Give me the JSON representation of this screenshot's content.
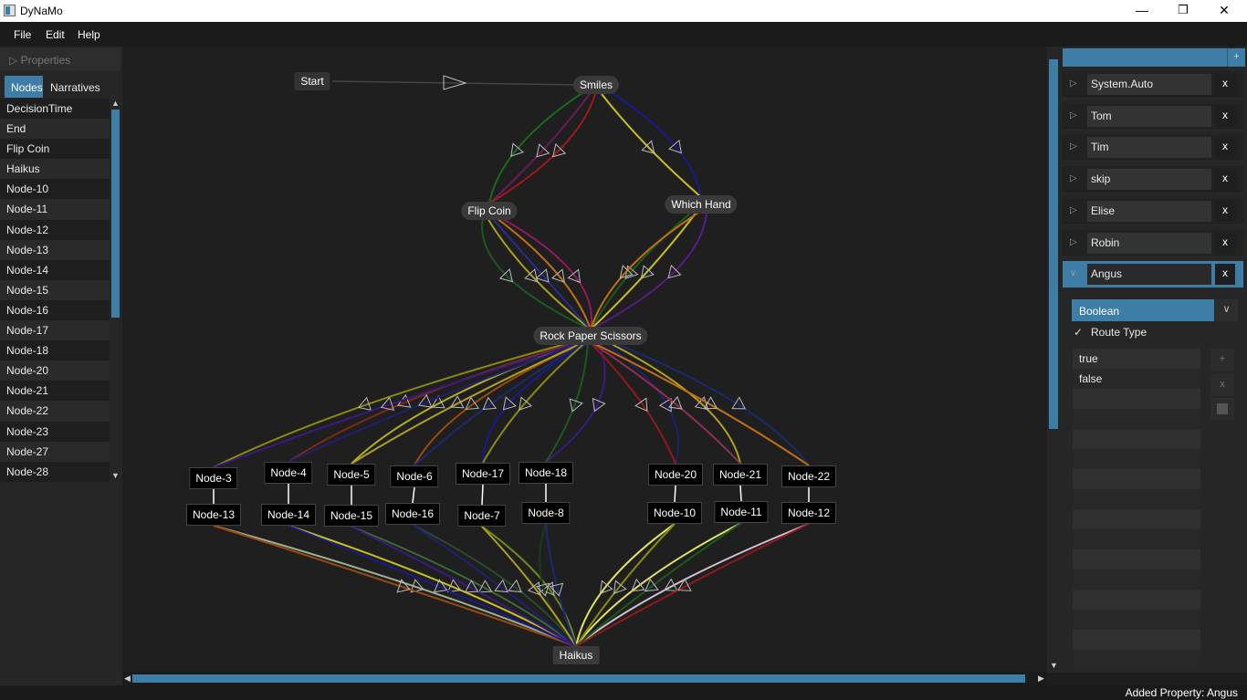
{
  "window": {
    "title": "DyNaMo",
    "minimize": "—",
    "maximize": "❐",
    "close": "✕"
  },
  "menu": [
    "File",
    "Edit",
    "Help"
  ],
  "sidebar": {
    "properties_header": "Properties",
    "tabs": [
      "Nodes",
      "Narratives"
    ],
    "active_tab": "Nodes",
    "nodes": [
      "DecisionTime",
      "End",
      "Flip Coin",
      "Haikus",
      "Node-10",
      "Node-11",
      "Node-12",
      "Node-13",
      "Node-14",
      "Node-15",
      "Node-16",
      "Node-17",
      "Node-18",
      "Node-20",
      "Node-21",
      "Node-22",
      "Node-23",
      "Node-27",
      "Node-28"
    ]
  },
  "graph": {
    "start": "Start",
    "smiles": "Smiles",
    "flip_coin": "Flip Coin",
    "which_hand": "Which Hand",
    "rps": "Rock Paper Scissors",
    "haikus": "Haikus",
    "top_row": [
      "Node-3",
      "Node-4",
      "Node-5",
      "Node-6",
      "Node-17",
      "Node-18",
      "Node-20",
      "Node-21",
      "Node-22"
    ],
    "bottom_row": [
      "Node-13",
      "Node-14",
      "Node-15",
      "Node-16",
      "Node-7",
      "Node-8",
      "Node-10",
      "Node-11",
      "Node-12"
    ]
  },
  "right_panel": {
    "add_label": "+",
    "properties": [
      {
        "name": "System.Auto",
        "expanded": false
      },
      {
        "name": "Tom",
        "expanded": false
      },
      {
        "name": "Tim",
        "expanded": false
      },
      {
        "name": "skip",
        "expanded": false
      },
      {
        "name": "Elise",
        "expanded": false
      },
      {
        "name": "Robin",
        "expanded": false
      },
      {
        "name": "Angus",
        "expanded": true
      }
    ],
    "remove_label": "x",
    "type": "Boolean",
    "route_type_label": "Route Type",
    "route_type_checked": true,
    "values": [
      "true",
      "false"
    ],
    "value_buttons": [
      "+",
      "x"
    ]
  },
  "status": "Added Property: Angus",
  "colors": {
    "accent": "#3e7ea6",
    "canvas": "#1f1f1f"
  }
}
